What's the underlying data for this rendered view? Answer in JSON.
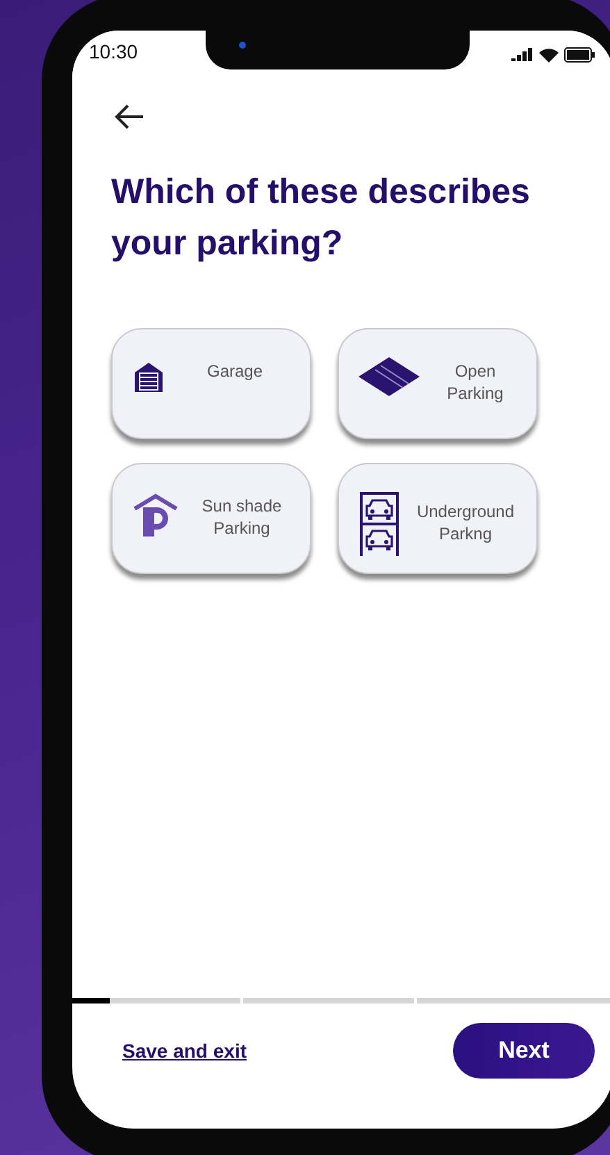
{
  "status_bar": {
    "time": "10:30"
  },
  "title": "Which of these describes your parking?",
  "options": [
    {
      "kind": "garage",
      "label": "Garage",
      "selected": false
    },
    {
      "kind": "open",
      "label": "Open Parking",
      "selected": false
    },
    {
      "kind": "sunshade",
      "label": "Sun shade Parking",
      "selected": false
    },
    {
      "kind": "underground",
      "label": "Underground Parkng",
      "selected": false
    }
  ],
  "progress": {
    "level": 0.07
  },
  "footer": {
    "link": "Save and exit",
    "button": "Next"
  }
}
